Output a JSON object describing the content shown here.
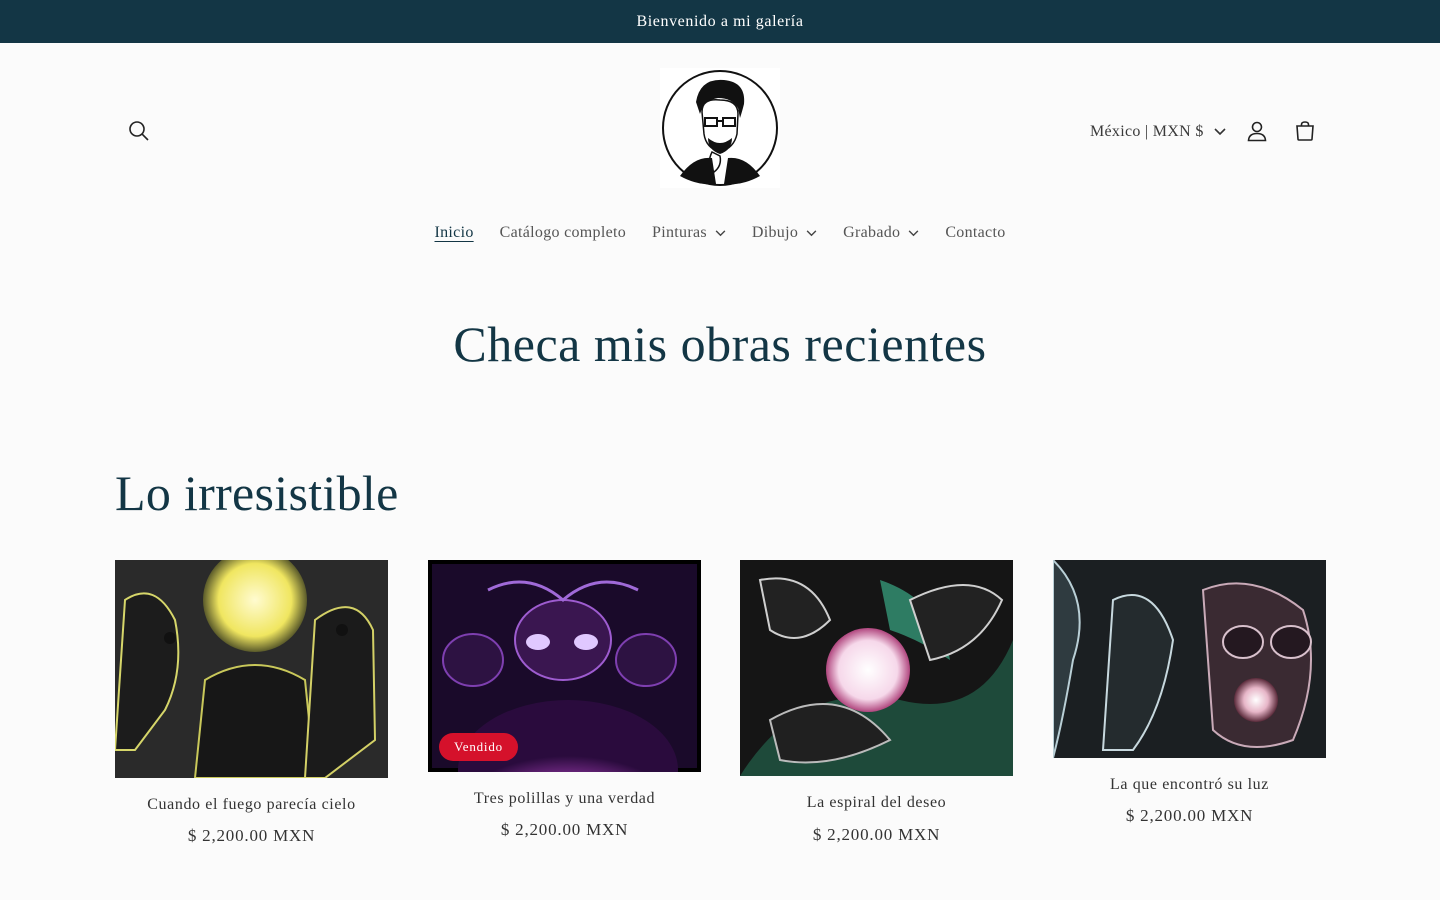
{
  "announcement": {
    "text": "Bienvenido a mi galería"
  },
  "header": {
    "search_icon": "search-icon",
    "logo_icon": "artist-portrait-logo",
    "locale_label": "México | MXN $",
    "account_icon": "user-icon",
    "cart_icon": "cart-icon"
  },
  "nav": {
    "items": [
      {
        "label": "Inicio",
        "active": true,
        "dropdown": false
      },
      {
        "label": "Catálogo completo",
        "active": false,
        "dropdown": false
      },
      {
        "label": "Pinturas",
        "active": false,
        "dropdown": true
      },
      {
        "label": "Dibujo",
        "active": false,
        "dropdown": true
      },
      {
        "label": "Grabado",
        "active": false,
        "dropdown": true
      },
      {
        "label": "Contacto",
        "active": false,
        "dropdown": false
      }
    ]
  },
  "hero": {
    "title": "Checa mis obras recientes"
  },
  "collection": {
    "title": "Lo irresistible",
    "products": [
      {
        "title": "Cuando el fuego parecía cielo",
        "price": "$ 2,200.00 MXN",
        "sold": false
      },
      {
        "title": "Tres polillas y una verdad",
        "price": "$ 2,200.00 MXN",
        "sold": true,
        "badge": "Vendido"
      },
      {
        "title": "La espiral del deseo",
        "price": "$ 2,200.00 MXN",
        "sold": false
      },
      {
        "title": "La que encontró su luz",
        "price": "$ 2,200.00 MXN",
        "sold": false
      }
    ]
  },
  "colors": {
    "announcement_bg": "#133645",
    "heading": "#133645",
    "sold_badge": "#d5112b",
    "page_bg": "#fbfbfb"
  }
}
